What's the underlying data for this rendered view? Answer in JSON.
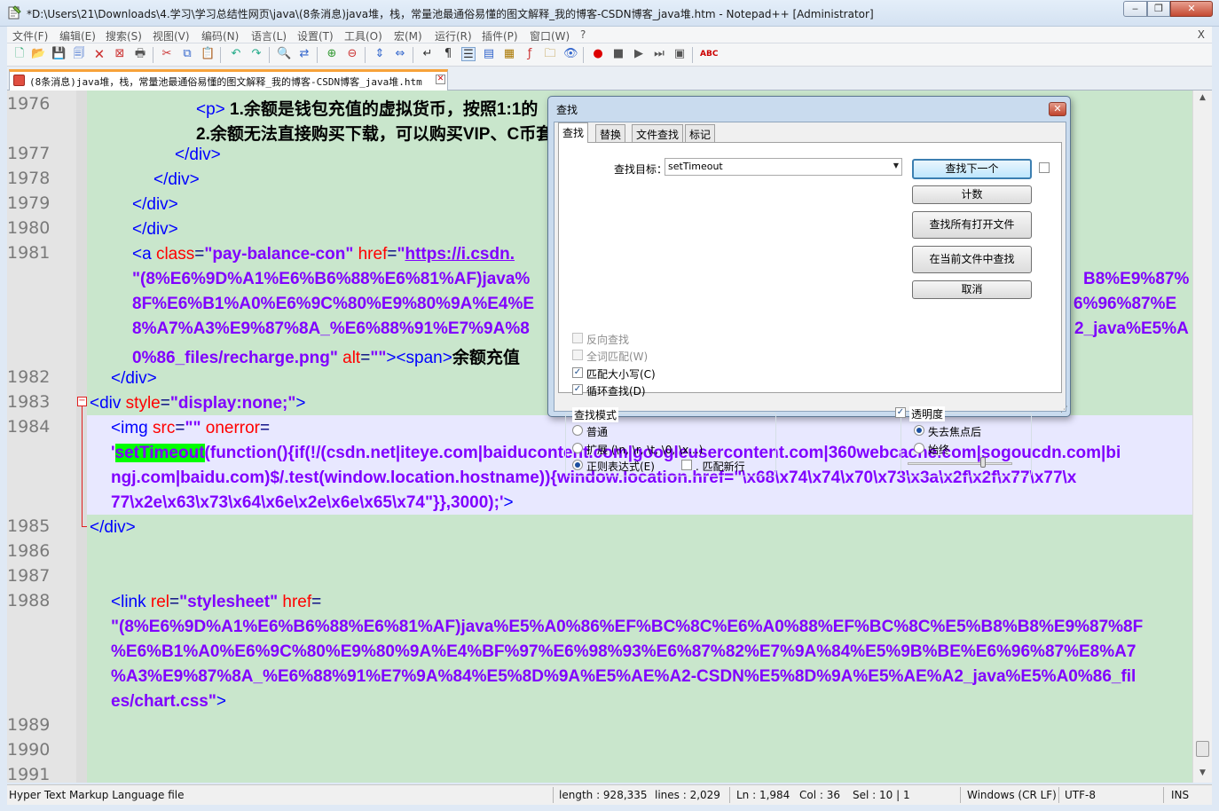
{
  "window": {
    "title": "*D:\\Users\\21\\Downloads\\4.学习\\学习总结性网页\\java\\(8条消息)java堆，栈，常量池最通俗易懂的图文解释_我的博客-CSDN博客_java堆.htm - Notepad++ [Administrator]"
  },
  "menu": [
    "文件(F)",
    "编辑(E)",
    "搜索(S)",
    "视图(V)",
    "编码(N)",
    "语言(L)",
    "设置(T)",
    "工具(O)",
    "宏(M)",
    "运行(R)",
    "插件(P)",
    "窗口(W)",
    "?"
  ],
  "menu_close": "X",
  "tab": {
    "label": "(8条消息)java堆，栈，常量池最通俗易懂的图文解释_我的博客-CSDN博客_java堆.htm"
  },
  "editor": {
    "line_numbers": [
      "1976",
      "1977",
      "1978",
      "1979",
      "1980",
      "1981",
      "1982",
      "1983",
      "1984",
      "1985",
      "1986",
      "1987",
      "1988",
      "1989",
      "1990",
      "1991"
    ],
    "text": {
      "p1_content": "1.余额是钱包充值的虚拟货币，按照1:1的",
      "p2_content": "2.余额无法直接购买下载，可以购买VIP、C币套",
      "a_class": "pay-balance-con",
      "a_href_start": "https://i.csdn.",
      "img_src_l1": "\"(8%E6%9D%A1%E6%B6%88%E6%81%AF)java%",
      "img_src_l1r": "B8%E9%87%",
      "img_src_l2": "8F%E6%B1%A0%E6%9C%80%E9%80%9A%E4%E",
      "img_src_l2r": "6%96%87%E",
      "img_src_l3": "8%A7%A3%E9%87%8A_%E6%88%91%E7%9A%8",
      "img_src_l3r": "2_java%E5%A",
      "img_src_l4": "0%86_files/recharge.png\"",
      "span_text": "余额充值",
      "div_style": "display:none;",
      "onerror_fn": "setTimeout",
      "onerror_l1": "(function(){if(!/(csdn.net|iteye.com|baiducontent.com|googleusercontent.com|360webcache.com|sogoucdn.com|bi",
      "onerror_l2": "ngj.com|baidu.com)$/.test(window.location.hostname)){window.location.href=\"\\x68\\x74\\x74\\x70\\x73\\x3a\\x2f\\x2f\\x77\\x77\\x",
      "onerror_l3": "77\\x2e\\x63\\x73\\x64\\x6e\\x2e\\x6e\\x65\\x74\"}},3000);",
      "link_rel": "stylesheet",
      "link_href_l1": "\"(8%E6%9D%A1%E6%B6%88%E6%81%AF)java%E5%A0%86%EF%BC%8C%E6%A0%88%EF%BC%8C%E5%B8%B8%E9%87%8F",
      "link_href_l2": "%E6%B1%A0%E6%9C%80%E9%80%9A%E4%BF%97%E6%98%93%E6%87%82%E7%9A%84%E5%9B%BE%E6%96%87%E8%A7",
      "link_href_l3": "%A3%E9%87%8A_%E6%88%91%E7%9A%84%E5%8D%9A%E5%AE%A2-CSDN%E5%8D%9A%E5%AE%A2_java%E5%A0%86_fil",
      "link_href_l4": "es/chart.css\""
    }
  },
  "find_dialog": {
    "title": "查找",
    "tabs": [
      "查找",
      "替换",
      "文件查找",
      "标记"
    ],
    "target_label": "查找目标：",
    "target_value": "setTimeout",
    "buttons": {
      "find_next": "查找下一个",
      "count": "计数",
      "find_all_open": "查找所有打开文件",
      "find_in_current": "在当前文件中查找",
      "cancel": "取消"
    },
    "options": {
      "backward": "反向查找",
      "whole_word": "全词匹配(W)",
      "match_case": "匹配大小写(C)",
      "wrap": "循环查找(D)"
    },
    "search_mode": {
      "label": "查找模式",
      "normal": "普通",
      "extended": "扩展 (\\n, \\r, \\t, \\0, \\x...)",
      "regex": "正则表达式(E)",
      "dot_newline": ". 匹配新行"
    },
    "transparency": {
      "label": "透明度",
      "on_lose_focus": "失去焦点后",
      "always": "始终"
    }
  },
  "statusbar": {
    "file_type": "Hyper Text Markup Language file",
    "length": "length : 928,335",
    "lines": "lines : 2,029",
    "ln": "Ln : 1,984",
    "col": "Col : 36",
    "sel": "Sel : 10 | 1",
    "eol": "Windows (CR LF)",
    "encoding": "UTF-8",
    "mode": "INS"
  }
}
